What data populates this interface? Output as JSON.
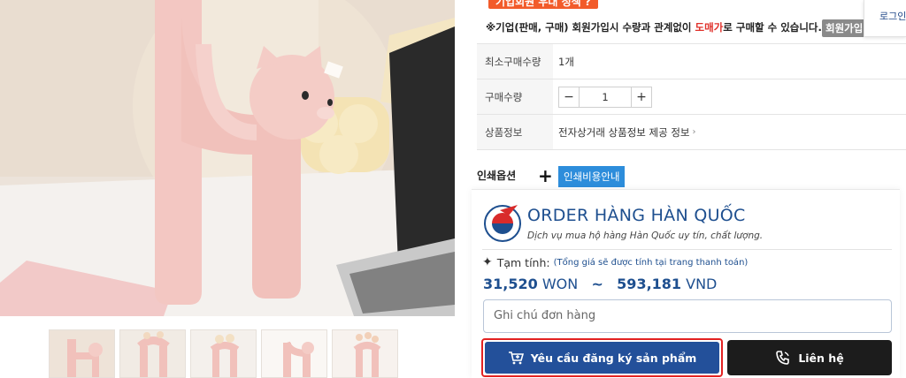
{
  "promo_banner": "기업회원 우대 정책 ?",
  "notice": {
    "prefix": "※기업(판매, 구매) 회원가입시 수량과 관계없이 ",
    "highlight": "도매가",
    "suffix": "로 구매할 수 있습니다.",
    "highlight_color": "#e0302a"
  },
  "member_button": "회원가입",
  "login_popup": "로그인",
  "info": {
    "min_qty_label": "최소구매수량",
    "min_qty_value": "1개",
    "qty_label": "구매수량",
    "qty_minus": "−",
    "qty_value": "1",
    "qty_plus": "+",
    "product_info_label": "상품정보",
    "product_info_value": "전자상거래 상품정보 제공 정보",
    "product_info_chevron": "›"
  },
  "print_option_label": "인쇄옵션",
  "print_plus": "+",
  "print_guide_button": "인쇄비용안내",
  "order_card": {
    "brand_name": "ORDER HÀNG HÀN QUỐC",
    "brand_sub": "Dịch vụ mua hộ hàng Hàn Quốc uy tín, chất lượng.",
    "subtotal_label": "Tạm tính:",
    "subtotal_note": "(Tổng giá sẽ được tính tại trang thanh toán)",
    "price_won": "31,520",
    "won_unit": "WON",
    "tilde": "~",
    "price_vnd": "593,181",
    "vnd_unit": "VND",
    "note_placeholder": "Ghi chú đơn hàng",
    "register_button": "Yêu cầu đăng ký sản phẩm",
    "contact_button": "Liên hệ"
  },
  "colors": {
    "brand_blue": "#23509a",
    "accent_red": "#e32222",
    "print_blue": "#2d8ddb",
    "promo_orange": "#f25b2a"
  },
  "icons": [
    "cart-icon",
    "phone-icon",
    "sparkle-icon",
    "plus-icon",
    "chevron-right-icon"
  ]
}
